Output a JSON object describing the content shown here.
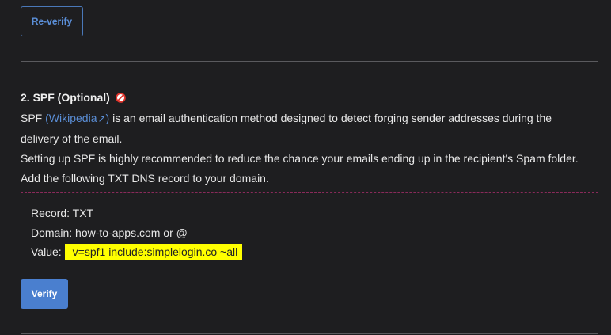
{
  "reverify_button": {
    "label": "Re-verify"
  },
  "spf_section": {
    "title": "2. SPF (Optional)",
    "status_icon": "no-entry-icon",
    "desc_prefix": "SPF ",
    "wikipedia_link": "(Wikipedia",
    "wikipedia_link_close": ")",
    "desc_suffix": " is an email authentication method designed to detect forging sender addresses during the delivery of the email.",
    "recommendation": "Setting up SPF is highly recommended to reduce the chance your emails ending up in the recipient's Spam folder.",
    "instruction": "Add the following TXT DNS record to your domain."
  },
  "dns_record": {
    "record_label": "Record:",
    "record_value": "TXT",
    "domain_label": "Domain:",
    "domain_value": "how-to-apps.com or @",
    "value_label": "Value:",
    "value": "v=spf1 include:simplelogin.co ~all"
  },
  "verify_button": {
    "label": "Verify"
  },
  "colors": {
    "background": "#1e1e20",
    "accent": "#4a7fcf",
    "link": "#5b8fd8",
    "highlight": "#ffff00",
    "box_border": "#8a2a5a",
    "status_icon": "#e0342c"
  }
}
